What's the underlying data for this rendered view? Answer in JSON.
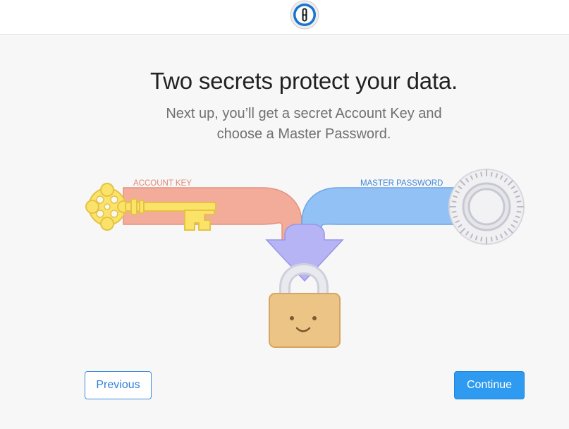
{
  "header": {
    "logo_icon": "1password-keyhole-icon"
  },
  "main": {
    "title": "Two secrets protect your data.",
    "subtitle_line1": "Next up, you’ll get a secret Account Key and",
    "subtitle_line2": "choose a Master Password."
  },
  "illustration": {
    "account_key_label": "ACCOUNT KEY",
    "master_password_label": "MASTER PASSWORD",
    "key_icon": "golden-key-icon",
    "dial_icon": "combination-dial-icon",
    "lock_icon": "smiling-padlock-icon",
    "colors": {
      "account_key": "#f1aa98",
      "master_password": "#8fbff4",
      "merge_arrow": "#b6b4f4",
      "key": "#fbe36a",
      "lock": "#ecc486"
    }
  },
  "footer": {
    "previous_label": "Previous",
    "continue_label": "Continue"
  },
  "colors": {
    "accent": "#2e9bf0",
    "background": "#f7f7f7"
  }
}
